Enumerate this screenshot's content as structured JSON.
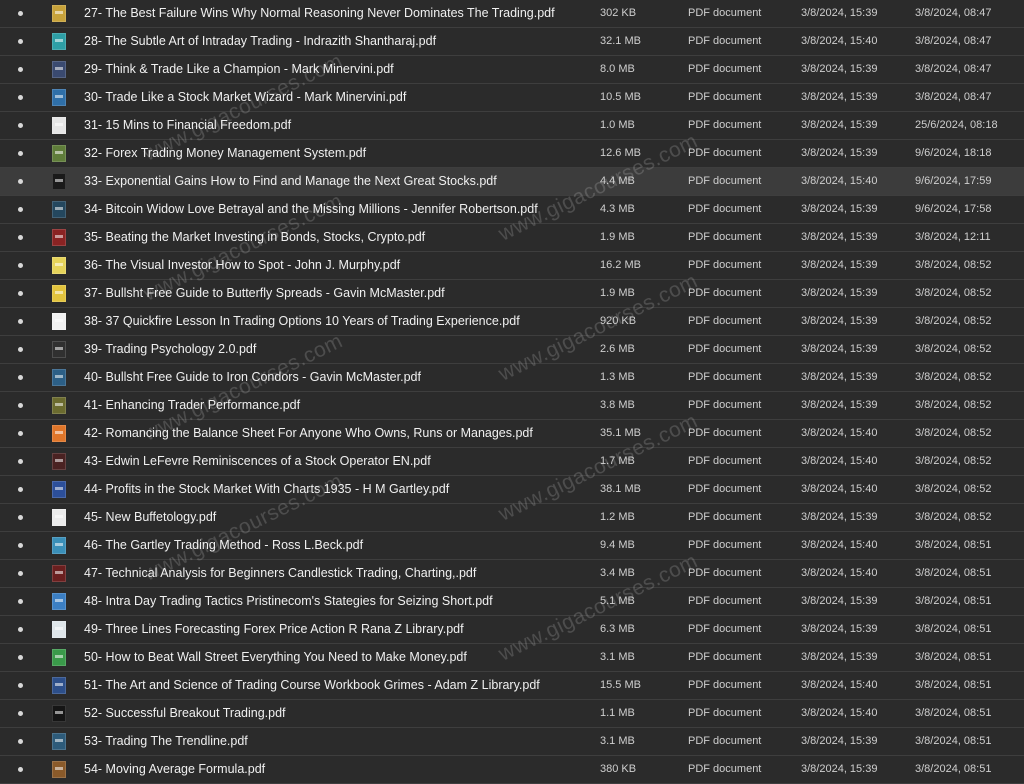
{
  "files": [
    {
      "name": "27- The Best Failure Wins Why Normal Reasoning Never Dominates The Trading.pdf",
      "size": "302 KB",
      "kind": "PDF document",
      "created": "3/8/2024, 15:39",
      "modified": "3/8/2024, 08:47",
      "thumb": "#c7a23a"
    },
    {
      "name": "28- The Subtle Art of Intraday Trading - Indrazith Shantharaj.pdf",
      "size": "32.1 MB",
      "kind": "PDF document",
      "created": "3/8/2024, 15:40",
      "modified": "3/8/2024, 08:47",
      "thumb": "#2e9fa6"
    },
    {
      "name": "29- Think & Trade Like a Champion - Mark Minervini.pdf",
      "size": "8.0 MB",
      "kind": "PDF document",
      "created": "3/8/2024, 15:39",
      "modified": "3/8/2024, 08:47",
      "thumb": "#3a4a70"
    },
    {
      "name": "30- Trade Like a Stock Market Wizard - Mark Minervini.pdf",
      "size": "10.5 MB",
      "kind": "PDF document",
      "created": "3/8/2024, 15:39",
      "modified": "3/8/2024, 08:47",
      "thumb": "#2f6fa8"
    },
    {
      "name": "31- 15 Mins to Financial Freedom.pdf",
      "size": "1.0 MB",
      "kind": "PDF document",
      "created": "3/8/2024, 15:39",
      "modified": "25/6/2024, 08:18",
      "thumb": "#e6e6e6"
    },
    {
      "name": "32- Forex Trading Money Management System.pdf",
      "size": "12.6 MB",
      "kind": "PDF document",
      "created": "3/8/2024, 15:39",
      "modified": "9/6/2024, 18:18",
      "thumb": "#5f7d3a"
    },
    {
      "name": "33- Exponential Gains How to Find and Manage the Next Great Stocks.pdf",
      "size": "4.4 MB",
      "kind": "PDF document",
      "created": "3/8/2024, 15:40",
      "modified": "9/6/2024, 17:59",
      "thumb": "#1a1a1a"
    },
    {
      "name": "34- Bitcoin Widow Love Betrayal and the Missing Millions - Jennifer Robertson.pdf",
      "size": "4.3 MB",
      "kind": "PDF document",
      "created": "3/8/2024, 15:39",
      "modified": "9/6/2024, 17:58",
      "thumb": "#24475e"
    },
    {
      "name": "35- Beating the Market Investing in Bonds, Stocks, Crypto.pdf",
      "size": "1.9 MB",
      "kind": "PDF document",
      "created": "3/8/2024, 15:39",
      "modified": "3/8/2024, 12:11",
      "thumb": "#8a2323"
    },
    {
      "name": "36- The Visual Investor How to Spot - John J. Murphy.pdf",
      "size": "16.2 MB",
      "kind": "PDF document",
      "created": "3/8/2024, 15:39",
      "modified": "3/8/2024, 08:52",
      "thumb": "#e5d35a"
    },
    {
      "name": "37- Bullsht Free Guide to Butterfly Spreads - Gavin McMaster.pdf",
      "size": "1.9 MB",
      "kind": "PDF document",
      "created": "3/8/2024, 15:39",
      "modified": "3/8/2024, 08:52",
      "thumb": "#e2c33d"
    },
    {
      "name": "38- 37 Quickfire Lesson In Trading Options 10 Years of Trading Experience.pdf",
      "size": "920 KB",
      "kind": "PDF document",
      "created": "3/8/2024, 15:39",
      "modified": "3/8/2024, 08:52",
      "thumb": "#f2f2f2"
    },
    {
      "name": "39- Trading Psychology 2.0.pdf",
      "size": "2.6 MB",
      "kind": "PDF document",
      "created": "3/8/2024, 15:39",
      "modified": "3/8/2024, 08:52",
      "thumb": "#303030"
    },
    {
      "name": "40- Bullsht Free Guide to Iron Condors - Gavin McMaster.pdf",
      "size": "1.3 MB",
      "kind": "PDF document",
      "created": "3/8/2024, 15:39",
      "modified": "3/8/2024, 08:52",
      "thumb": "#2c5f86"
    },
    {
      "name": "41- Enhancing Trader Performance.pdf",
      "size": "3.8 MB",
      "kind": "PDF document",
      "created": "3/8/2024, 15:39",
      "modified": "3/8/2024, 08:52",
      "thumb": "#6b6b2f"
    },
    {
      "name": "42- Romancing the Balance Sheet For Anyone Who Owns, Runs or Manages.pdf",
      "size": "35.1 MB",
      "kind": "PDF document",
      "created": "3/8/2024, 15:40",
      "modified": "3/8/2024, 08:52",
      "thumb": "#e0762a"
    },
    {
      "name": "43- Edwin LeFevre Reminiscences of a Stock Operator EN.pdf",
      "size": "1.7 MB",
      "kind": "PDF document",
      "created": "3/8/2024, 15:40",
      "modified": "3/8/2024, 08:52",
      "thumb": "#4a2222"
    },
    {
      "name": "44- Profits in the Stock Market With Charts 1935 - H M Gartley.pdf",
      "size": "38.1 MB",
      "kind": "PDF document",
      "created": "3/8/2024, 15:40",
      "modified": "3/8/2024, 08:52",
      "thumb": "#2c4f9a"
    },
    {
      "name": "45- New Buffetology.pdf",
      "size": "1.2 MB",
      "kind": "PDF document",
      "created": "3/8/2024, 15:39",
      "modified": "3/8/2024, 08:52",
      "thumb": "#ececec"
    },
    {
      "name": "46- The Gartley Trading Method - Ross L.Beck.pdf",
      "size": "9.4 MB",
      "kind": "PDF document",
      "created": "3/8/2024, 15:40",
      "modified": "3/8/2024, 08:51",
      "thumb": "#3a8fb8"
    },
    {
      "name": "47- Technical Analysis for Beginners Candlestick Trading, Charting,.pdf",
      "size": "3.4 MB",
      "kind": "PDF document",
      "created": "3/8/2024, 15:40",
      "modified": "3/8/2024, 08:51",
      "thumb": "#6a1f1f"
    },
    {
      "name": "48- Intra Day Trading Tactics Pristinecom's Stategies for Seizing Short.pdf",
      "size": "5.1 MB",
      "kind": "PDF document",
      "created": "3/8/2024, 15:39",
      "modified": "3/8/2024, 08:51",
      "thumb": "#3b7fc4"
    },
    {
      "name": "49- Three Lines Forecasting Forex Price Action R Rana Z Library.pdf",
      "size": "6.3 MB",
      "kind": "PDF document",
      "created": "3/8/2024, 15:39",
      "modified": "3/8/2024, 08:51",
      "thumb": "#dfe6ea"
    },
    {
      "name": "50- How to Beat Wall Street Everything You Need to Make Money.pdf",
      "size": "3.1 MB",
      "kind": "PDF document",
      "created": "3/8/2024, 15:39",
      "modified": "3/8/2024, 08:51",
      "thumb": "#3a9a4a"
    },
    {
      "name": "51- The Art and Science of Trading Course Workbook Grimes - Adam Z Library.pdf",
      "size": "15.5 MB",
      "kind": "PDF document",
      "created": "3/8/2024, 15:40",
      "modified": "3/8/2024, 08:51",
      "thumb": "#2d4f8a"
    },
    {
      "name": "52- Successful Breakout Trading.pdf",
      "size": "1.1 MB",
      "kind": "PDF document",
      "created": "3/8/2024, 15:40",
      "modified": "3/8/2024, 08:51",
      "thumb": "#151515"
    },
    {
      "name": "53- Trading The Trendline.pdf",
      "size": "3.1 MB",
      "kind": "PDF document",
      "created": "3/8/2024, 15:39",
      "modified": "3/8/2024, 08:51",
      "thumb": "#2d5b7a"
    },
    {
      "name": "54- Moving Average Formula.pdf",
      "size": "380 KB",
      "kind": "PDF document",
      "created": "3/8/2024, 15:39",
      "modified": "3/8/2024, 08:51",
      "thumb": "#8a5a2a"
    }
  ],
  "selected_index": 6,
  "watermark_text": "www.gigacourses.com"
}
